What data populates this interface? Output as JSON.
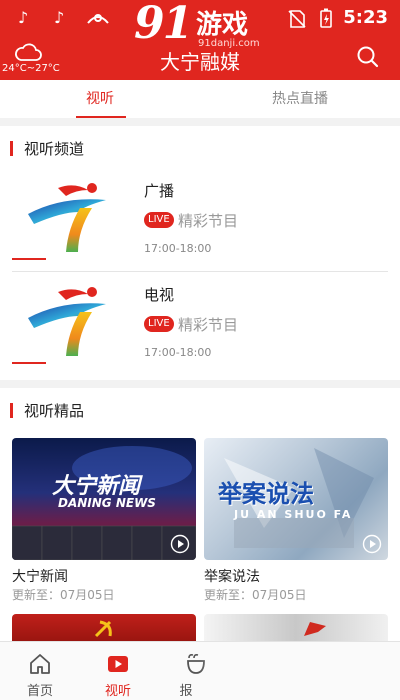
{
  "status_bar": {
    "time": "5:23",
    "icons": [
      "tiktok-icon",
      "tiktok-icon",
      "app-notification-icon",
      "no-sim-icon",
      "battery-icon"
    ]
  },
  "watermark": {
    "number": "91",
    "text": "游戏",
    "site": "91danji.com"
  },
  "header": {
    "title": "大宁融媒",
    "weather": "24°C~27°C",
    "weather_icon": "cloud-icon",
    "search_icon": "search-icon"
  },
  "tabs": [
    {
      "label": "视听",
      "active": true
    },
    {
      "label": "热点直播",
      "active": false
    }
  ],
  "channels_section": {
    "title": "视听频道",
    "items": [
      {
        "name": "广播",
        "badge": "LIVE",
        "desc": "精彩节目",
        "time": "17:00-18:00"
      },
      {
        "name": "电视",
        "badge": "LIVE",
        "desc": "精彩节目",
        "time": "17:00-18:00"
      }
    ]
  },
  "featured_section": {
    "title": "视听精品",
    "cards": [
      {
        "title": "大宁新闻",
        "subtitle": "更新至：07月05日",
        "image_text": "大宁新闻",
        "image_subtext": "DANING NEWS"
      },
      {
        "title": "举案说法",
        "subtitle": "更新至：07月05日",
        "image_text": "举案说法",
        "image_subtext": "JU AN SHUO FA"
      }
    ]
  },
  "bottom_nav": [
    {
      "label": "首页",
      "icon": "home-icon",
      "active": false
    },
    {
      "label": "视听",
      "icon": "play-icon",
      "active": true
    },
    {
      "label": "报",
      "icon": "newspaper-icon",
      "active": false
    }
  ],
  "colors": {
    "brand_red": "#e0261f",
    "text_dark": "#222222",
    "text_gray": "#999999"
  }
}
